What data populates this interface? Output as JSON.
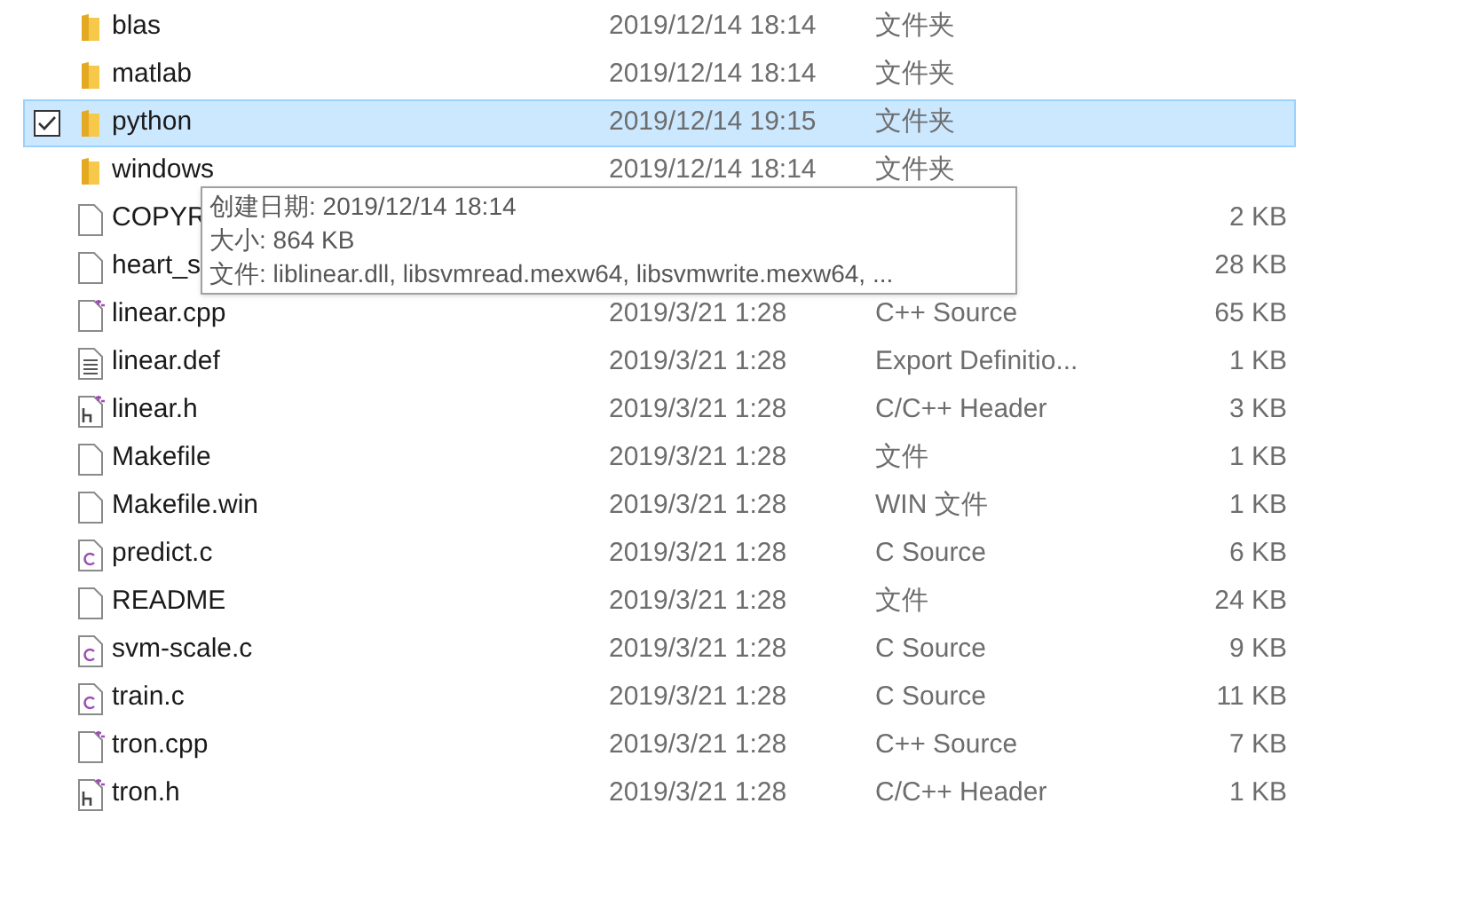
{
  "files": [
    {
      "kind": "folder",
      "name": "blas",
      "date": "2019/12/14 18:14",
      "type": "文件夹",
      "selected": false
    },
    {
      "kind": "folder",
      "name": "matlab",
      "date": "2019/12/14 18:14",
      "type": "文件夹",
      "selected": false
    },
    {
      "kind": "folder",
      "name": "python",
      "date": "2019/12/14 19:15",
      "type": "文件夹",
      "selected": true
    },
    {
      "kind": "folder",
      "name": "windows",
      "date": "2019/12/14 18:14",
      "type": "文件夹",
      "selected": false
    },
    {
      "kind": "file",
      "name": "COPYR",
      "size": "2 KB",
      "selected": false
    },
    {
      "kind": "file",
      "name": "heart_s",
      "size": "28 KB",
      "selected": false
    },
    {
      "kind": "cpp",
      "name": "linear.cpp",
      "date": "2019/3/21 1:28",
      "type": "C++ Source",
      "size": "65 KB",
      "selected": false
    },
    {
      "kind": "text",
      "name": "linear.def",
      "date": "2019/3/21 1:28",
      "type": "Export Definitio...",
      "size": "1 KB",
      "selected": false
    },
    {
      "kind": "header",
      "name": "linear.h",
      "date": "2019/3/21 1:28",
      "type": "C/C++ Header",
      "size": "3 KB",
      "selected": false
    },
    {
      "kind": "file",
      "name": "Makefile",
      "date": "2019/3/21 1:28",
      "type": "文件",
      "size": "1 KB",
      "selected": false
    },
    {
      "kind": "file",
      "name": "Makefile.win",
      "date": "2019/3/21 1:28",
      "type": "WIN 文件",
      "size": "1 KB",
      "selected": false
    },
    {
      "kind": "c",
      "name": "predict.c",
      "date": "2019/3/21 1:28",
      "type": "C Source",
      "size": "6 KB",
      "selected": false
    },
    {
      "kind": "file",
      "name": "README",
      "date": "2019/3/21 1:28",
      "type": "文件",
      "size": "24 KB",
      "selected": false
    },
    {
      "kind": "c",
      "name": "svm-scale.c",
      "date": "2019/3/21 1:28",
      "type": "C Source",
      "size": "9 KB",
      "selected": false
    },
    {
      "kind": "c",
      "name": "train.c",
      "date": "2019/3/21 1:28",
      "type": "C Source",
      "size": "11 KB",
      "selected": false
    },
    {
      "kind": "cpp",
      "name": "tron.cpp",
      "date": "2019/3/21 1:28",
      "type": "C++ Source",
      "size": "7 KB",
      "selected": false
    },
    {
      "kind": "header",
      "name": "tron.h",
      "date": "2019/3/21 1:28",
      "type": "C/C++ Header",
      "size": "1 KB",
      "selected": false
    }
  ],
  "tooltip": {
    "lines": [
      "创建日期: 2019/12/14 18:14",
      "大小: 864 KB",
      "文件: liblinear.dll, libsvmread.mexw64, libsvmwrite.mexw64, ..."
    ]
  }
}
